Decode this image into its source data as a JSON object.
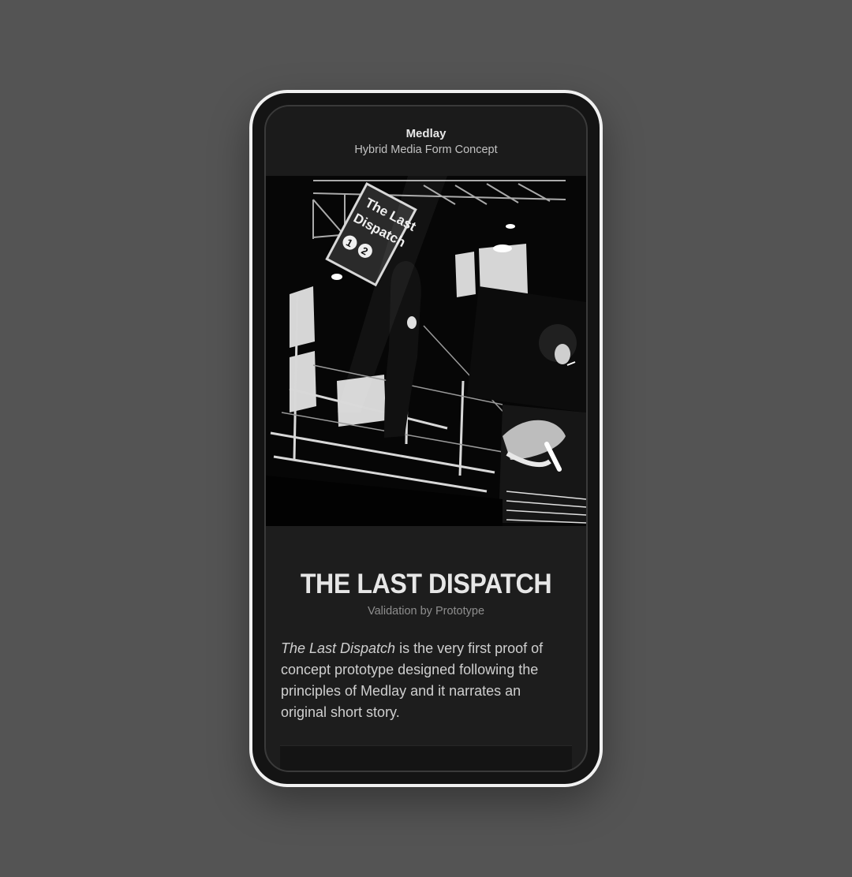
{
  "header": {
    "app_title": "Medlay",
    "app_subtitle": "Hybrid Media Form Concept"
  },
  "hero": {
    "sign_line1": "The Last",
    "sign_line2": "Dispatch",
    "sign_badge1": "1",
    "sign_badge2": "2"
  },
  "story": {
    "title": "THE LAST DISPATCH",
    "subtitle": "Validation by Prototype",
    "desc_italic": "The Last Dispatch",
    "desc_rest": " is the very first proof of concept prototype designed following the principles of Medlay and it narrates an original short story."
  },
  "colors": {
    "page_background": "#545454",
    "phone_frame": "#f1f1f1",
    "screen_background": "#1d1d1d"
  }
}
